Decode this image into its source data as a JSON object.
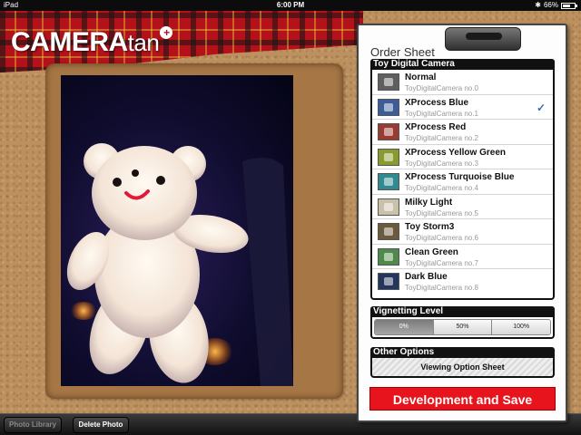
{
  "status_bar": {
    "device": "iPad",
    "time": "6:00 PM",
    "battery": "66%",
    "battery_level": 0.66
  },
  "app": {
    "logo_main": "CAMERA",
    "logo_sub": "tan",
    "logo_plus": "+"
  },
  "toolbar": {
    "photo_library": "Photo Library",
    "delete_photo": "Delete Photo"
  },
  "sheet": {
    "title": "Order Sheet",
    "camera_header": "Toy Digital Camera",
    "items": [
      {
        "name": "Normal",
        "sub": "ToyDigitalCamera no.0",
        "swatch": "#5f5f5f",
        "check": ""
      },
      {
        "name": "XProcess Blue",
        "sub": "ToyDigitalCamera no.1",
        "swatch": "#3d5d9a",
        "check": "✓"
      },
      {
        "name": "XProcess Red",
        "sub": "ToyDigitalCamera no.2",
        "swatch": "#9a3b32",
        "check": ""
      },
      {
        "name": "XProcess Yellow Green",
        "sub": "ToyDigitalCamera no.3",
        "swatch": "#8a9a2e",
        "check": ""
      },
      {
        "name": "XProcess Turquoise Blue",
        "sub": "ToyDigitalCamera no.4",
        "swatch": "#2f8a91",
        "check": ""
      },
      {
        "name": "Milky Light",
        "sub": "ToyDigitalCamera no.5",
        "swatch": "#c9c2a8",
        "check": ""
      },
      {
        "name": "Toy Storm3",
        "sub": "ToyDigitalCamera no.6",
        "swatch": "#6b5a3b",
        "check": ""
      },
      {
        "name": "Clean Green",
        "sub": "ToyDigitalCamera no.7",
        "swatch": "#4e8a4a",
        "check": ""
      },
      {
        "name": "Dark Blue",
        "sub": "ToyDigitalCamera no.8",
        "swatch": "#24365e",
        "check": ""
      }
    ],
    "vignetting_header": "Vignetting Level",
    "vignetting_options": [
      "0%",
      "50%",
      "100%"
    ],
    "vignetting_selected": "0%",
    "other_header": "Other Options",
    "viewing_option": "Viewing Option Sheet",
    "dev_save": "Development and Save"
  },
  "colors": {
    "accent_red": "#e8141d",
    "check_blue": "#3a6bb0"
  }
}
